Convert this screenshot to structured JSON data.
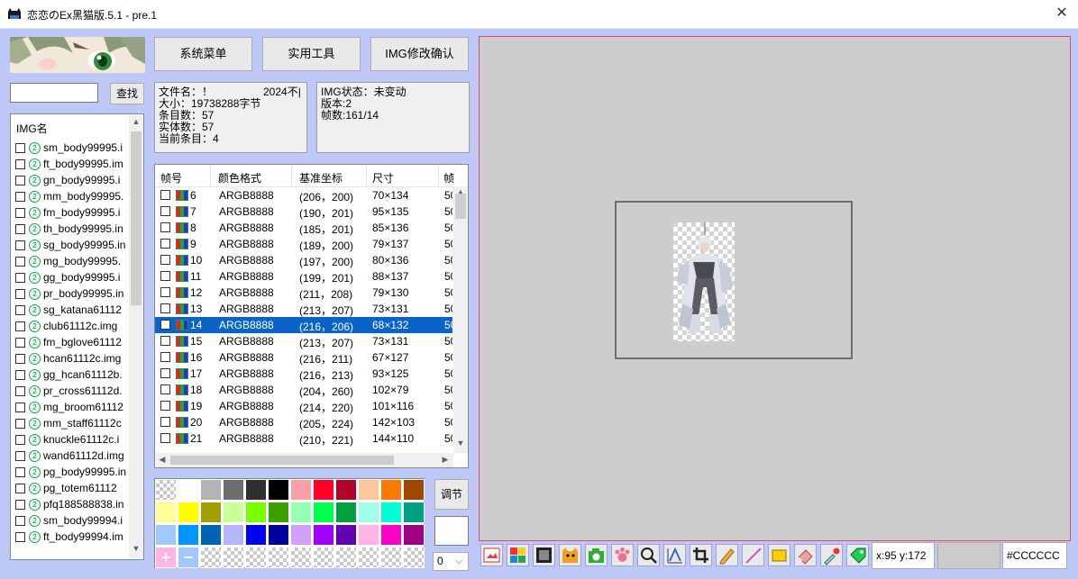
{
  "window": {
    "title": "恋恋のEx黑猫版.5.1 - pre.1",
    "close_glyph": "✕"
  },
  "search": {
    "value": "",
    "button": "查找"
  },
  "img_list": {
    "header": "IMG名",
    "items": [
      {
        "name": "sm_body99995.i",
        "checked": false
      },
      {
        "name": "ft_body99995.im",
        "checked": false
      },
      {
        "name": "gn_body99995.i",
        "checked": false
      },
      {
        "name": "mm_body99995.",
        "checked": false
      },
      {
        "name": "fm_body99995.i",
        "checked": false
      },
      {
        "name": "th_body99995.in",
        "checked": false
      },
      {
        "name": "sg_body99995.in",
        "checked": false
      },
      {
        "name": "mg_body99995.",
        "checked": false
      },
      {
        "name": "gg_body99995.i",
        "checked": false
      },
      {
        "name": "pr_body99995.in",
        "checked": false
      },
      {
        "name": "sg_katana61112",
        "checked": false
      },
      {
        "name": "club61112c.img",
        "checked": false
      },
      {
        "name": "fm_bglove61112",
        "checked": false
      },
      {
        "name": "hcan61112c.img",
        "checked": false
      },
      {
        "name": "gg_hcan61112b.",
        "checked": false
      },
      {
        "name": "pr_cross61112d.",
        "checked": false
      },
      {
        "name": "mg_broom61112",
        "checked": false
      },
      {
        "name": "mm_staff61112c",
        "checked": false
      },
      {
        "name": "knuckle61112c.i",
        "checked": false
      },
      {
        "name": "wand61112d.img",
        "checked": false
      },
      {
        "name": "pg_body99995.in",
        "checked": false
      },
      {
        "name": "pg_totem61112",
        "checked": false
      },
      {
        "name": "pfq188588838.in",
        "checked": false
      },
      {
        "name": "sm_body99994.i",
        "checked": false
      },
      {
        "name": "ft_body99994.im",
        "checked": false
      }
    ]
  },
  "top_buttons": {
    "system_menu": "系统菜单",
    "tools": "实用工具",
    "img_confirm": "IMG修改确认"
  },
  "file_info": {
    "filename": "文件名：！",
    "year": "2024不|",
    "size": "大小：19738288字节",
    "entries": "条目数：57",
    "entities": "实体数：57",
    "current": "当前条目：4"
  },
  "img_info": {
    "status": "IMG状态：未变动",
    "version": "版本:2",
    "frames": "帧数:161/14"
  },
  "frame_table": {
    "columns": [
      "帧号",
      "颜色格式",
      "基准坐标",
      "尺寸",
      "帧"
    ],
    "rows": [
      {
        "id": "6",
        "format": "ARGB8888",
        "coord": "(206，200)",
        "size": "70×134",
        "extra": "50",
        "selected": false
      },
      {
        "id": "7",
        "format": "ARGB8888",
        "coord": "(190，201)",
        "size": "95×135",
        "extra": "50",
        "selected": false
      },
      {
        "id": "8",
        "format": "ARGB8888",
        "coord": "(185，201)",
        "size": "85×136",
        "extra": "50",
        "selected": false
      },
      {
        "id": "9",
        "format": "ARGB8888",
        "coord": "(189，200)",
        "size": "79×137",
        "extra": "50",
        "selected": false
      },
      {
        "id": "10",
        "format": "ARGB8888",
        "coord": "(197，200)",
        "size": "80×136",
        "extra": "50",
        "selected": false
      },
      {
        "id": "11",
        "format": "ARGB8888",
        "coord": "(199，201)",
        "size": "88×137",
        "extra": "50",
        "selected": false
      },
      {
        "id": "12",
        "format": "ARGB8888",
        "coord": "(211，208)",
        "size": "79×130",
        "extra": "50",
        "selected": false
      },
      {
        "id": "13",
        "format": "ARGB8888",
        "coord": "(213，207)",
        "size": "73×131",
        "extra": "50",
        "selected": false
      },
      {
        "id": "14",
        "format": "ARGB8888",
        "coord": "(216，206)",
        "size": "68×132",
        "extra": "50",
        "selected": true
      },
      {
        "id": "15",
        "format": "ARGB8888",
        "coord": "(213，207)",
        "size": "73×131",
        "extra": "50",
        "selected": false
      },
      {
        "id": "16",
        "format": "ARGB8888",
        "coord": "(216，211)",
        "size": "67×127",
        "extra": "50",
        "selected": false
      },
      {
        "id": "17",
        "format": "ARGB8888",
        "coord": "(216，213)",
        "size": "93×125",
        "extra": "50",
        "selected": false
      },
      {
        "id": "18",
        "format": "ARGB8888",
        "coord": "(204，260)",
        "size": "102×79",
        "extra": "50",
        "selected": false
      },
      {
        "id": "19",
        "format": "ARGB8888",
        "coord": "(214，220)",
        "size": "101×116",
        "extra": "50",
        "selected": false
      },
      {
        "id": "20",
        "format": "ARGB8888",
        "coord": "(205，224)",
        "size": "142×103",
        "extra": "50",
        "selected": false
      },
      {
        "id": "21",
        "format": "ARGB8888",
        "coord": "(210，221)",
        "size": "144×110",
        "extra": "50",
        "selected": false
      }
    ]
  },
  "palette": {
    "rows": [
      [
        "checker",
        "#ffffff",
        "#b4b4b4",
        "#6e6e6e",
        "#2f2f2f",
        "#000000",
        "#ffa0a8",
        "#ff0028",
        "#b4002d",
        "#ffc89a",
        "#ff7800",
        "#a04800"
      ],
      [
        "#ffff96",
        "#ffff00",
        "#a0a000",
        "#c8ff96",
        "#78ff00",
        "#3ca000",
        "#96ffb4",
        "#00ff50",
        "#00a03c",
        "#a0ffe6",
        "#00ffd2",
        "#00a082"
      ],
      [
        "#a0c8ff",
        "#0096ff",
        "#0064b4",
        "#b4b4ff",
        "#0000ff",
        "#00009a",
        "#d2a0ff",
        "#a000ff",
        "#6400b4",
        "#ffb4e6",
        "#ff00c8",
        "#a00082"
      ],
      [
        "plus",
        "minus",
        "checker",
        "checker",
        "checker",
        "checker",
        "checker",
        "checker",
        "checker",
        "checker",
        "checker",
        "checker"
      ]
    ],
    "plus_glyph": "+",
    "minus_glyph": "−"
  },
  "adjust_button": "调节",
  "number_select": {
    "value": "0",
    "arrow": "⌵"
  },
  "colors": {
    "background": "#bdc8f7",
    "canvas": "#cdcdcd",
    "selection": "#0a64c8",
    "canvas_border": "#e8446a"
  },
  "tools": [
    "image-edit-icon",
    "palette-icon",
    "film-icon",
    "cat-icon",
    "camera-icon",
    "paw-icon",
    "magnifier-icon",
    "axis-icon",
    "crop-icon",
    "pencil-icon",
    "line-icon",
    "rectangle-icon",
    "eraser-icon",
    "eyedropper-icon",
    "tag-icon"
  ],
  "status": {
    "coords": "x:95 y:172",
    "hex": "#CCCCCC"
  }
}
